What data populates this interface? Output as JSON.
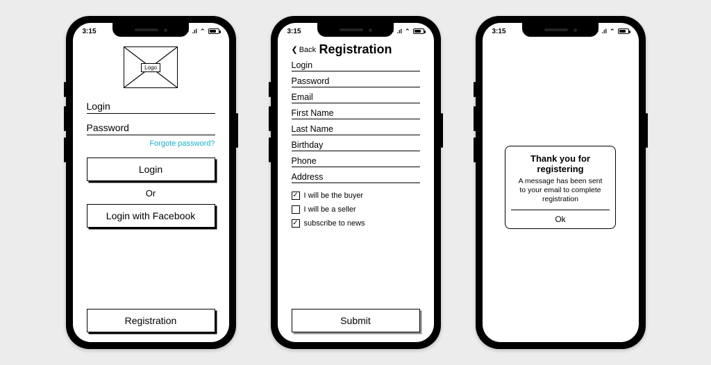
{
  "status": {
    "time": "3:15",
    "signal": "▪▫",
    "wifi": "⌃"
  },
  "screen1": {
    "logo_label": "Logo",
    "login_ph": "Login",
    "password_ph": "Password",
    "forgot": "Forgote password?",
    "login_btn": "Login",
    "or": "Or",
    "facebook_btn": "Login with Facebook",
    "registration_btn": "Registration"
  },
  "screen2": {
    "back": "Back",
    "title": "Registration",
    "fields": {
      "login": "Login",
      "password": "Password",
      "email": "Email",
      "first_name": "First Name",
      "last_name": "Last Name",
      "birthday": "Birthday",
      "phone": "Phone",
      "address": "Address"
    },
    "checks": {
      "buyer": {
        "label": "I will be the buyer",
        "checked": true
      },
      "seller": {
        "label": "I will be a seller",
        "checked": false
      },
      "news": {
        "label": "subscribe to news",
        "checked": true
      }
    },
    "submit_btn": "Submit"
  },
  "screen3": {
    "title": "Thank you for registering",
    "message": "A message has been sent to your email to complete registration",
    "ok": "Ok"
  }
}
